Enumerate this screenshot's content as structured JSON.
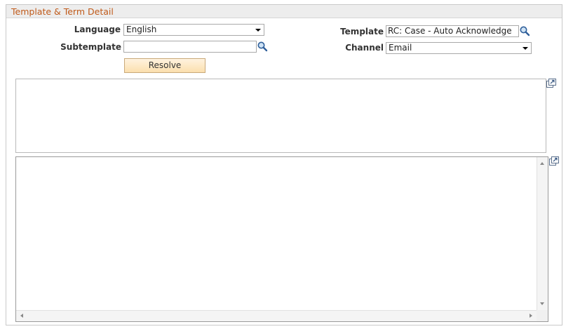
{
  "panel": {
    "title": "Template & Term Detail"
  },
  "form": {
    "language": {
      "label": "Language",
      "value": "English"
    },
    "subtemplate": {
      "label": "Subtemplate",
      "value": ""
    },
    "template": {
      "label": "Template",
      "value": "RC: Case - Auto Acknowledge"
    },
    "channel": {
      "label": "Channel",
      "value": "Email"
    },
    "resolve_label": "Resolve"
  },
  "icons": {
    "lookup": "magnifier-icon",
    "expand": "expand-window-icon"
  }
}
